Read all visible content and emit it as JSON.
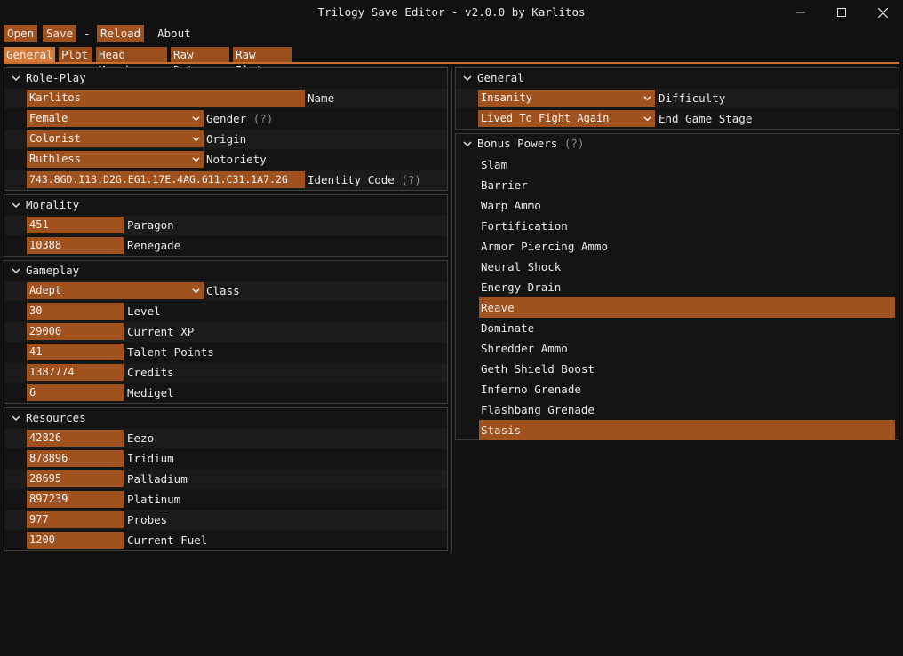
{
  "window": {
    "title": "Trilogy Save Editor - v2.0.0 by Karlitos"
  },
  "menu": {
    "open": "Open",
    "save": "Save",
    "sep": "-",
    "reload": "Reload",
    "about": "About"
  },
  "tabs": [
    "General",
    "Plot",
    "Head Morph",
    "Raw Data",
    "Raw Plot"
  ],
  "roleplay": {
    "title": "Role-Play",
    "name_value": "Karlitos",
    "name_label": "Name",
    "gender_value": "Female",
    "gender_label": "Gender",
    "origin_value": "Colonist",
    "origin_label": "Origin",
    "notoriety_value": "Ruthless",
    "notoriety_label": "Notoriety",
    "identity_value": "743.8GD.I13.D2G.EG1.17E.4AG.611.C31.1A7.2G",
    "identity_label": "Identity Code",
    "hint": "(?)"
  },
  "morality": {
    "title": "Morality",
    "paragon_value": "451",
    "paragon_label": "Paragon",
    "renegade_value": "10388",
    "renegade_label": "Renegade"
  },
  "gameplay": {
    "title": "Gameplay",
    "class_value": "Adept",
    "class_label": "Class",
    "level_value": "30",
    "level_label": "Level",
    "xp_value": "29000",
    "xp_label": "Current XP",
    "talent_value": "41",
    "talent_label": "Talent Points",
    "credits_value": "1387774",
    "credits_label": "Credits",
    "medigel_value": "6",
    "medigel_label": "Medigel"
  },
  "resources": {
    "title": "Resources",
    "eezo_value": "42826",
    "eezo_label": "Eezo",
    "iridium_value": "878896",
    "iridium_label": "Iridium",
    "palladium_value": "28695",
    "palladium_label": "Palladium",
    "platinum_value": "897239",
    "platinum_label": "Platinum",
    "probes_value": "977",
    "probes_label": "Probes",
    "fuel_value": "1200",
    "fuel_label": "Current Fuel"
  },
  "general": {
    "title": "General",
    "difficulty_value": "Insanity",
    "difficulty_label": "Difficulty",
    "endgame_value": "Lived To Fight Again",
    "endgame_label": "End Game Stage"
  },
  "bonus_powers": {
    "title": "Bonus Powers",
    "hint": "(?)",
    "items": [
      {
        "label": "Slam",
        "selected": false
      },
      {
        "label": "Barrier",
        "selected": false
      },
      {
        "label": "Warp Ammo",
        "selected": false
      },
      {
        "label": "Fortification",
        "selected": false
      },
      {
        "label": "Armor Piercing Ammo",
        "selected": false
      },
      {
        "label": "Neural Shock",
        "selected": false
      },
      {
        "label": "Energy Drain",
        "selected": false
      },
      {
        "label": "Reave",
        "selected": true
      },
      {
        "label": "Dominate",
        "selected": false
      },
      {
        "label": "Shredder Ammo",
        "selected": false
      },
      {
        "label": "Geth Shield Boost",
        "selected": false
      },
      {
        "label": "Inferno Grenade",
        "selected": false
      },
      {
        "label": "Flashbang Grenade",
        "selected": false
      },
      {
        "label": "Stasis",
        "selected": true
      }
    ]
  },
  "colors": {
    "accent": "#a0521e",
    "accent_active": "#d27a3c",
    "background": "#111111",
    "panel": "#141414"
  }
}
